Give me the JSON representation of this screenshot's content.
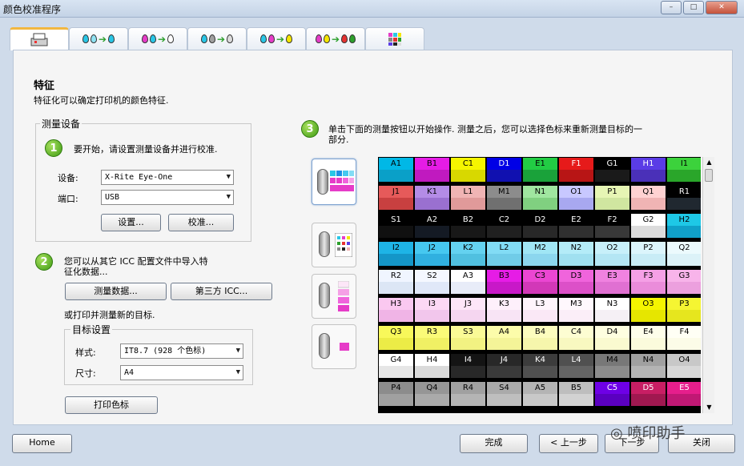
{
  "window": {
    "title": "颜色校准程序",
    "buttons": [
      "–",
      "□",
      "✕"
    ]
  },
  "tabs": [
    {
      "name": "printer-tab",
      "active": true
    },
    {
      "name": "cyan-tab",
      "active": false
    },
    {
      "name": "magenta-tab",
      "active": false
    },
    {
      "name": "gray-tab",
      "active": false
    },
    {
      "name": "yellow-tab",
      "active": false
    },
    {
      "name": "rgb-tab",
      "active": false
    },
    {
      "name": "target-tab",
      "active": false
    }
  ],
  "page": {
    "title": "特征",
    "subtitle": "特征化可以确定打印机的颜色特征."
  },
  "device_group": {
    "label": "测量设备",
    "step1_text": "要开始，请设置测量设备并进行校准.",
    "device_label": "设备:",
    "device_value": "X-Rite Eye-One",
    "port_label": "端口:",
    "port_value": "USB",
    "setup_button": "设置...",
    "calibrate_button": "校准..."
  },
  "step2": {
    "text_line1": "您可以从其它 ICC 配置文件中导入特",
    "text_line2": "征化数据...",
    "measure_button": "测量数据...",
    "thirdparty_button": "第三方 ICC...",
    "or_text": "或打印并测量新的目标."
  },
  "target_group": {
    "label": "目标设置",
    "style_label": "样式:",
    "style_value": "IT8.7 (928 个色标)",
    "size_label": "尺寸:",
    "size_value": "A4",
    "print_button": "打印色标"
  },
  "step3": {
    "text_line1": "单击下面的测量按钮以开始操作. 测量之后，您可以选择色标来重新测量目标的一",
    "text_line2": "部分."
  },
  "footer": {
    "home_button": "Home",
    "done_button": "完成",
    "prev_button": "< 上一步",
    "next_button": "下一步",
    "close_button": "关闭"
  },
  "watermark": "喷印助手",
  "steps": [
    "1",
    "2",
    "3"
  ],
  "patch_rows": [
    [
      [
        "A1",
        "#00b8e6",
        "#0aa0c8"
      ],
      [
        "B1",
        "#e61ce6",
        "#c01abf"
      ],
      [
        "C1",
        "#f5f500",
        "#d8d800"
      ],
      [
        "D1",
        "#0000e6",
        "#1010b0"
      ],
      [
        "E1",
        "#22cc44",
        "#1aa23a"
      ],
      [
        "F1",
        "#e61a1a",
        "#b81515"
      ],
      [
        "G1",
        "#000000",
        "#1a1a1a"
      ],
      [
        "H1",
        "#5a3ce6",
        "#4a30b8"
      ],
      [
        "I1",
        "#3cd23c",
        "#2aa62a"
      ]
    ],
    [
      [
        "J1",
        "#e65a5a",
        "#c84040"
      ],
      [
        "K1",
        "#b48ce6",
        "#9a70d0"
      ],
      [
        "L1",
        "#f0b4b4",
        "#e09a9a"
      ],
      [
        "M1",
        "#8c8c8c",
        "#707070"
      ],
      [
        "N1",
        "#a0e6a0",
        "#80d080"
      ],
      [
        "O1",
        "#c8c8ff",
        "#a8a8f0"
      ],
      [
        "P1",
        "#e6f5b4",
        "#d0e6a0"
      ],
      [
        "Q1",
        "#ffd2d2",
        "#f0b4b4"
      ],
      [
        "R1",
        "#000000",
        "#202830"
      ]
    ],
    [
      [
        "S1",
        "#000000",
        "#101010"
      ],
      [
        "A2",
        "#000000",
        "#141a24"
      ],
      [
        "B2",
        "#000000",
        "#181818"
      ],
      [
        "C2",
        "#000000",
        "#202020"
      ],
      [
        "D2",
        "#000000",
        "#282828"
      ],
      [
        "E2",
        "#000000",
        "#303030"
      ],
      [
        "F2",
        "#000000",
        "#383838"
      ],
      [
        "G2",
        "#ffffff",
        "#dcdcdc"
      ],
      [
        "H2",
        "#1ec8e6",
        "#10a0c8"
      ]
    ],
    [
      [
        "I2",
        "#1eb4e6",
        "#1496c8"
      ],
      [
        "J2",
        "#46c8f0",
        "#30b0e0"
      ],
      [
        "K2",
        "#64d2f0",
        "#50c0e0"
      ],
      [
        "L2",
        "#82dcf5",
        "#70cce8"
      ],
      [
        "M2",
        "#a0e6f5",
        "#8cd6ee"
      ],
      [
        "N2",
        "#b4ecf8",
        "#a0e0f0"
      ],
      [
        "O2",
        "#c8f0fa",
        "#b4e6f4"
      ],
      [
        "P2",
        "#dcf5fc",
        "#c8ecf6"
      ],
      [
        "Q2",
        "#ecfafd",
        "#dcf2f8"
      ]
    ],
    [
      [
        "R2",
        "#f0f5ff",
        "#dce6f5"
      ],
      [
        "S2",
        "#f5f8ff",
        "#e0e8f8"
      ],
      [
        "A3",
        "#ffffff",
        "#e8ecf8"
      ],
      [
        "B3",
        "#e61ce6",
        "#c818c8"
      ],
      [
        "C3",
        "#eb46d2",
        "#d238b8"
      ],
      [
        "D3",
        "#f064dc",
        "#dc50c8"
      ],
      [
        "E3",
        "#f082e0",
        "#e070d2"
      ],
      [
        "F3",
        "#f5a0e6",
        "#ea8cda"
      ],
      [
        "G3",
        "#f8b4ea",
        "#eca0de"
      ]
    ],
    [
      [
        "H3",
        "#fac8f0",
        "#f0b4e6"
      ],
      [
        "I3",
        "#fcd8f4",
        "#f2c6ec"
      ],
      [
        "J3",
        "#fde6f8",
        "#f5d6f0"
      ],
      [
        "K3",
        "#fef0fb",
        "#f8e4f5"
      ],
      [
        "L3",
        "#fff5fc",
        "#fae8f6"
      ],
      [
        "M3",
        "#fff8fd",
        "#fbeef8"
      ],
      [
        "N3",
        "#ffffff",
        "#f5f0f5"
      ],
      [
        "O3",
        "#f5f500",
        "#e6e600"
      ],
      [
        "P3",
        "#f5f532",
        "#e6e61e"
      ]
    ],
    [
      [
        "Q3",
        "#f8f85a",
        "#ecec46"
      ],
      [
        "R3",
        "#fafa78",
        "#f0f064"
      ],
      [
        "S3",
        "#fafa96",
        "#f2f282"
      ],
      [
        "A4",
        "#fcfcaa",
        "#f4f498"
      ],
      [
        "B4",
        "#fcfcbe",
        "#f6f6ac"
      ],
      [
        "C4",
        "#fdfdd2",
        "#f8f8c0"
      ],
      [
        "D4",
        "#fefee0",
        "#fafad0"
      ],
      [
        "E4",
        "#fefeea",
        "#fbfbdc"
      ],
      [
        "F4",
        "#fffff5",
        "#fcfce8"
      ]
    ],
    [
      [
        "G4",
        "#ffffff",
        "#e6e6e6"
      ],
      [
        "H4",
        "#ffffff",
        "#dadada"
      ],
      [
        "I4",
        "#141414",
        "#282828"
      ],
      [
        "J4",
        "#282828",
        "#3a3a3a"
      ],
      [
        "K4",
        "#3c3c3c",
        "#505050"
      ],
      [
        "L4",
        "#505050",
        "#646464"
      ],
      [
        "M4",
        "#787878",
        "#8c8c8c"
      ],
      [
        "N4",
        "#a0a0a0",
        "#b4b4b4"
      ],
      [
        "O4",
        "#c8c8c8",
        "#d8d8d8"
      ]
    ],
    [
      [
        "P4",
        "#8c8c8c",
        "#a0a0a0"
      ],
      [
        "Q4",
        "#969696",
        "#aaaaaa"
      ],
      [
        "R4",
        "#a0a0a0",
        "#b4b4b4"
      ],
      [
        "S4",
        "#aaaaaa",
        "#bebebe"
      ],
      [
        "A5",
        "#b4b4b4",
        "#c8c8c8"
      ],
      [
        "B5",
        "#bebebe",
        "#d2d2d2"
      ],
      [
        "C5",
        "#6e00e6",
        "#5a00c0"
      ],
      [
        "D5",
        "#c81e64",
        "#a01850"
      ],
      [
        "E5",
        "#e61e8c",
        "#c01874"
      ]
    ]
  ]
}
